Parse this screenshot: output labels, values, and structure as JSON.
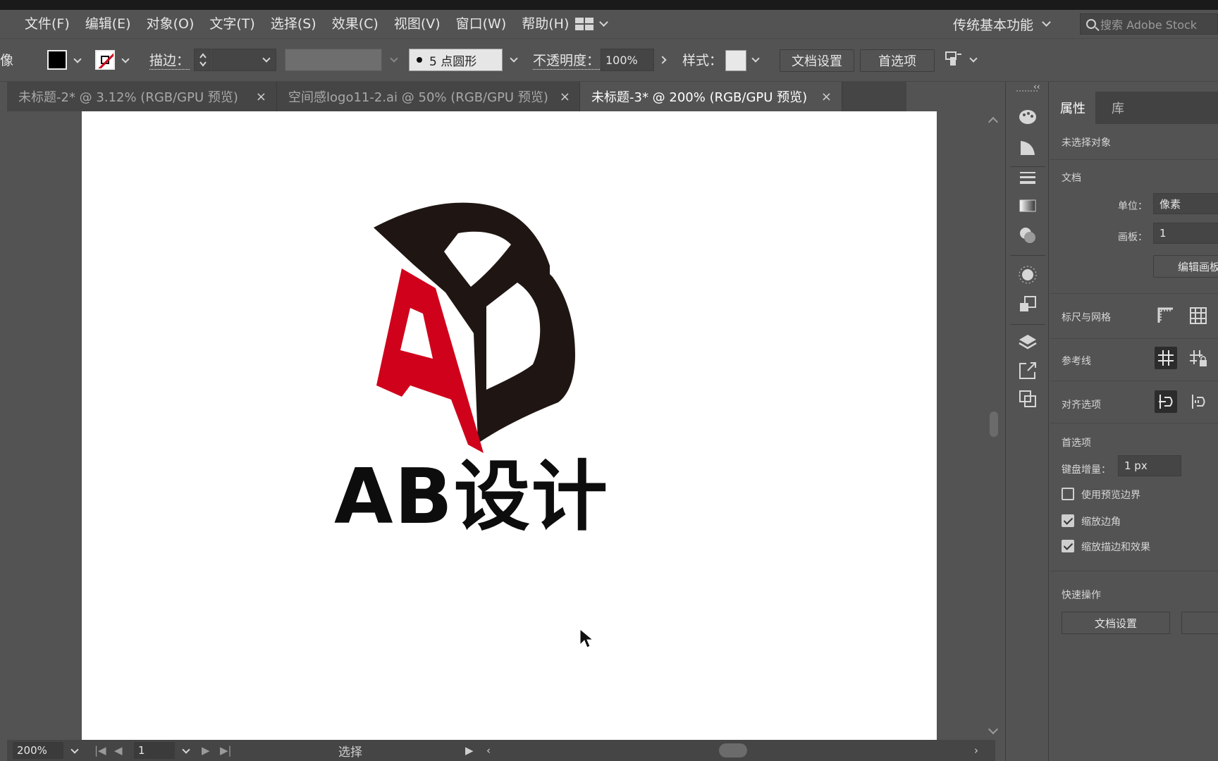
{
  "menu": [
    "文件(F)",
    "编辑(E)",
    "对象(O)",
    "文字(T)",
    "选择(S)",
    "效果(C)",
    "视图(V)",
    "窗口(W)",
    "帮助(H)"
  ],
  "workspace": "传统基本功能",
  "stock_search_placeholder": "搜索 Adobe Stock",
  "control": {
    "left_cut_label": "像",
    "stroke_label": "描边：",
    "brush_label": "5 点圆形",
    "opacity_label": "不透明度：",
    "opacity_value": "100%",
    "style_label": "样式：",
    "doc_setup": "文档设置",
    "preferences": "首选项"
  },
  "tabs": [
    {
      "label": "未标题-2* @ 3.12% (RGB/GPU 预览)",
      "close": "×",
      "active": false
    },
    {
      "label": "空间感logo11-2.ai @ 50% (RGB/GPU 预览)",
      "close": "×",
      "active": false
    },
    {
      "label": "未标题-3* @ 200% (RGB/GPU 预览)",
      "close": "×",
      "active": true
    }
  ],
  "artwork": {
    "wordmark": "AB设计",
    "colors": {
      "red": "#d0021b",
      "dark": "#1f1613"
    }
  },
  "status": {
    "zoom": "200%",
    "artboard": "1",
    "tool": "选择"
  },
  "panel": {
    "collapse_glyph": "‹‹",
    "tab_properties": "属性",
    "tab_library": "库",
    "no_selection": "未选择对象",
    "document": "文档",
    "units_label": "单位：",
    "units_value": "像素",
    "artboard_label": "画板：",
    "artboard_value": "1",
    "edit_artboards": "编辑画板",
    "rulers_grids": "标尺与网格",
    "guides": "参考线",
    "align_options": "对齐选项",
    "preferences": "首选项",
    "keyboard_increment_label": "键盘增量：",
    "keyboard_increment_value": "1 px",
    "use_preview_bounds": "使用预览边界",
    "use_preview_bounds_checked": false,
    "scale_corners": "缩放边角",
    "scale_corners_checked": true,
    "scale_strokes": "缩放描边和效果",
    "scale_strokes_checked": true,
    "quick_actions": "快速操作",
    "qa_doc_setup": "文档设置"
  }
}
